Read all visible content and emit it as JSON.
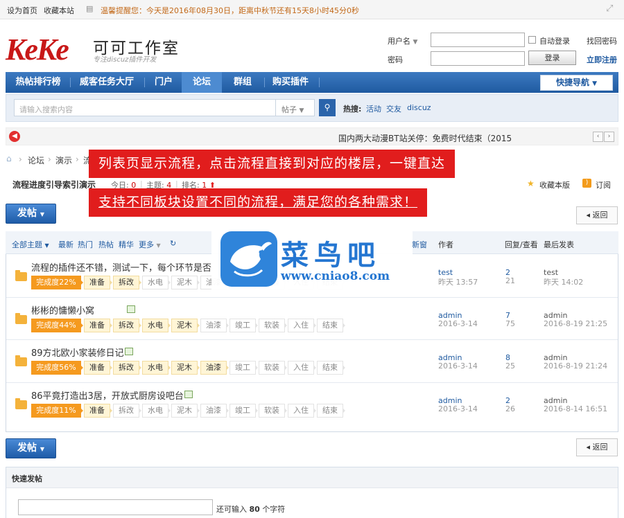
{
  "topbar": {
    "set_home": "设为首页",
    "bookmark": "收藏本站",
    "notice": "温馨提醒您：今天是2016年08月30日，距离中秋节还有15天8小时45分0秒"
  },
  "logo": {
    "mark": "KeKe",
    "name": "可可工作室",
    "slogan": "专注discuz插件开发"
  },
  "login": {
    "username_label": "用户名",
    "password_label": "密码",
    "remember_label": "自动登录",
    "forgot": "找回密码",
    "login_button": "登录",
    "register": "立即注册"
  },
  "nav": {
    "items": [
      "热帖排行榜",
      "威客任务大厅",
      "门户",
      "论坛",
      "群组",
      "购买插件"
    ],
    "quick": "快捷导航"
  },
  "search": {
    "placeholder": "请输入搜索内容",
    "scope": "帖子",
    "hot_label": "热搜:",
    "hot": [
      "活动",
      "交友",
      "discuz"
    ]
  },
  "notice_bar": {
    "text": "国内两大动漫BT站关停：免费时代结束（2015"
  },
  "breadcrumb": {
    "items": [
      "论坛",
      "演示",
      "流"
    ]
  },
  "banners": {
    "line1": "列表页显示流程，点击流程直接到对应的楼层，一键直达",
    "line2": "支持不同板块设置不同的流程，满足您的各种需求！"
  },
  "forum": {
    "title": "流程进度引导索引演示",
    "today_label": "今日:",
    "today": "0",
    "topics_label": "主题:",
    "topics": "4",
    "rank_label": "排名:",
    "rank": "1",
    "fav": "收藏本版",
    "rss": "订阅"
  },
  "buttons": {
    "post": "发帖",
    "back": "返回"
  },
  "table": {
    "filters": [
      "全部主题",
      "最新",
      "热门",
      "热帖",
      "精华",
      "更多"
    ],
    "new_window": "新窗",
    "col_author": "作者",
    "col_reply": "回复/查看",
    "col_last": "最后发表"
  },
  "stages": [
    "准备",
    "拆改",
    "水电",
    "泥木",
    "油漆",
    "竣工",
    "软装",
    "入住",
    "结束"
  ],
  "threads": [
    {
      "title": "流程的插件还不错，测试一下，每个环节是否",
      "pct": "完成度22%",
      "done": 2,
      "author": "test",
      "date": "昨天 13:57",
      "replies": "2",
      "views": "21",
      "last_user": "test",
      "last_time": "昨天 14:02"
    },
    {
      "title": "彬彬的慵懒小窝",
      "pct": "完成度44%",
      "done": 4,
      "author": "admin",
      "date": "2016-3-14",
      "replies": "7",
      "views": "75",
      "last_user": "admin",
      "last_time": "2016-8-19 21:25"
    },
    {
      "title": "89方北欧小家装修日记",
      "pct": "完成度56%",
      "done": 5,
      "author": "admin",
      "date": "2016-3-14",
      "replies": "8",
      "views": "25",
      "last_user": "admin",
      "last_time": "2016-8-19 21:24"
    },
    {
      "title": "86平竟打造出3居，开放式厨房设吧台",
      "pct": "完成度11%",
      "done": 1,
      "author": "admin",
      "date": "2016-3-14",
      "replies": "2",
      "views": "26",
      "last_user": "admin",
      "last_time": "2016-8-14 16:51"
    }
  ],
  "watermark": {
    "cn": "菜鸟吧",
    "url": "www.cniao8.com"
  },
  "quick_post": {
    "title": "快速发帖",
    "hint_pre": "还可输入",
    "count": "80",
    "hint_post": "个字符"
  }
}
